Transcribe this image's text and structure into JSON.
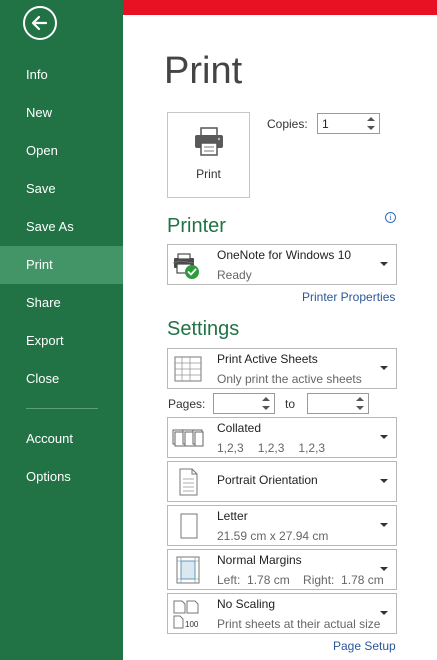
{
  "nav": {
    "back_label": "Back",
    "items": [
      {
        "label": "Info"
      },
      {
        "label": "New"
      },
      {
        "label": "Open"
      },
      {
        "label": "Save"
      },
      {
        "label": "Save As"
      },
      {
        "label": "Print",
        "active": true
      },
      {
        "label": "Share"
      },
      {
        "label": "Export"
      },
      {
        "label": "Close"
      },
      {
        "label": "Account"
      },
      {
        "label": "Options"
      }
    ]
  },
  "page_title": "Print",
  "print_button": {
    "label": "Print"
  },
  "copies": {
    "label": "Copies:",
    "value": "1"
  },
  "printer": {
    "section_title": "Printer",
    "name": "OneNote for Windows 10",
    "status": "Ready",
    "properties_link": "Printer Properties"
  },
  "settings": {
    "section_title": "Settings",
    "what_to_print": {
      "title": "Print Active Sheets",
      "subtitle": "Only print the active sheets"
    },
    "pages": {
      "label": "Pages:",
      "to_label": "to",
      "from_value": "",
      "to_value": ""
    },
    "collation": {
      "title": "Collated",
      "sequence": [
        "1,2,3",
        "1,2,3",
        "1,2,3"
      ]
    },
    "orientation": {
      "title": "Portrait Orientation"
    },
    "paper": {
      "title": "Letter",
      "subtitle": "21.59 cm x 27.94 cm"
    },
    "margins": {
      "title": "Normal Margins",
      "subtitle": "Left:  1.78 cm    Right:  1.78 cm"
    },
    "scaling": {
      "title": "No Scaling",
      "subtitle": "Print sheets at their actual size",
      "icon_text": "100"
    },
    "page_setup_link": "Page Setup"
  },
  "colors": {
    "sidebar_green": "#217346",
    "active_item": "#439467",
    "accent_red": "#e81123",
    "heading_green": "#217346",
    "link_blue": "#2b579a"
  }
}
